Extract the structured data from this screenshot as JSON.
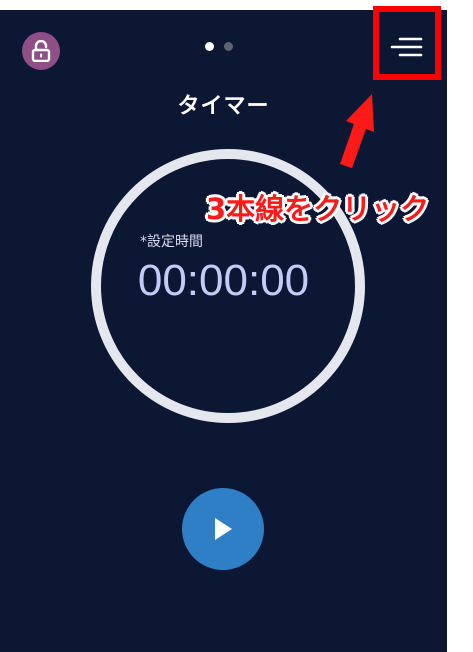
{
  "screen": {
    "title": "タイマー",
    "pager": {
      "page_count": 2,
      "active_index": 0
    }
  },
  "timer": {
    "set_label": "*設定時間",
    "value": "00:00:00"
  },
  "icons": {
    "lock": "lock-icon",
    "menu": "menu-icon",
    "play": "play-icon"
  },
  "annotation": {
    "text": "3本線をクリック"
  },
  "colors": {
    "background": "#0b1733",
    "lock_button": "#8f4f86",
    "play_button": "#2f7fc6",
    "ring": "#e5e7ee",
    "time_text": "#c3ccf5",
    "annotation": "#ff1a1a"
  }
}
